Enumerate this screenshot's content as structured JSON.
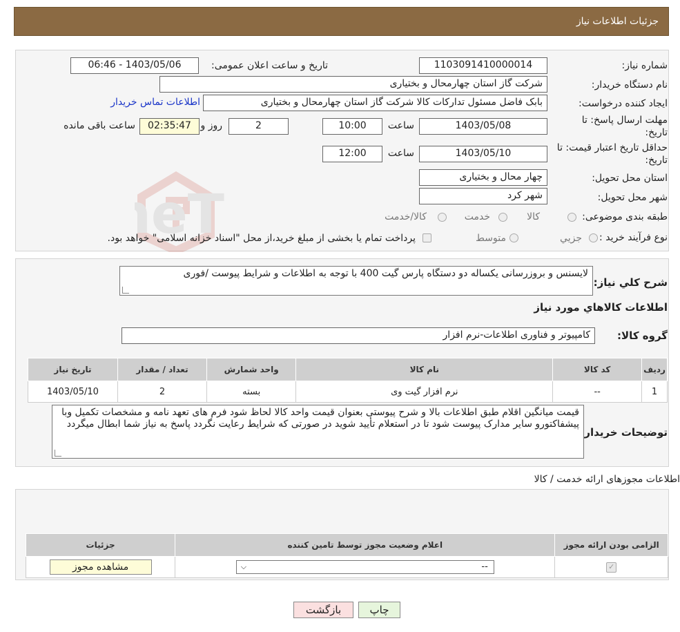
{
  "header": {
    "title": "جزئیات اطلاعات نیاز"
  },
  "details": {
    "need_number_label": "شماره نیاز:",
    "need_number": "1103091410000014",
    "announce_label": "تاریخ و ساعت اعلان عمومی:",
    "announce_value": "1403/05/06 - 06:46",
    "buyer_org_label": "نام دستگاه خریدار:",
    "buyer_org": "شرکت گاز استان چهارمحال و بختیاری",
    "creator_label": "ایجاد کننده درخواست:",
    "creator": "بابک فاضل  مسئول تدارکات کالا شرکت گاز استان چهارمحال و بختیاری",
    "contact_link": "اطلاعات تماس خریدار",
    "deadline_label_1": "مهلت ارسال پاسخ: تا",
    "deadline_label_2": "تاریخ:",
    "deadline_date": "1403/05/08",
    "time_label": "ساعت",
    "deadline_time": "10:00",
    "days_value": "2",
    "days_label": "روز و",
    "remaining_time": "02:35:47",
    "remaining_label": "ساعت باقی مانده",
    "validity_label_1": "حداقل تاریخ اعتبار قیمت: تا",
    "validity_label_2": "تاریخ:",
    "validity_date": "1403/05/10",
    "validity_time": "12:00",
    "province_label": "استان محل تحویل:",
    "province": "چهار محال و بختیاری",
    "city_label": "شهر محل تحویل:",
    "city": "شهر کرد",
    "category_label": "طبقه بندی موضوعی:",
    "category_options": [
      "کالا",
      "خدمت",
      "کالا/خدمت"
    ],
    "process_label": "نوع فرآیند خرید :",
    "process_options": [
      "جزیي",
      "متوسط"
    ],
    "payment_note": "پرداخت تمام یا بخشی از مبلغ خرید،از محل \"اسناد خزانه اسلامی\" خواهد بود."
  },
  "need": {
    "summary_label": "شرح كلي نياز:",
    "summary": "لایسنس و بروزرسانی یکساله دو دستگاه پارس گیت 400 با توجه به اطلاعات و شرایط پیوست /فوری",
    "goods_info_title": "اطلاعات كالاهاي مورد نياز",
    "group_label": "گروه کالا:",
    "group_value": "کامپیوتر و فناوری اطلاعات-نرم افزار",
    "table_headers": [
      "رديف",
      "کد کالا",
      "نام کالا",
      "واحد شمارش",
      "تعداد / مقدار",
      "تاریخ نیاز"
    ],
    "table_rows": [
      [
        "1",
        "--",
        "نرم افزار گیت وی",
        "بسته",
        "2",
        "1403/05/10"
      ]
    ],
    "buyer_notes_label": "توضیحات خریدار:",
    "buyer_notes": "قیمت میانگین اقلام طبق اطلاعات بالا و شرح پیوستی بعنوان قیمت واحد  کالا  لحاظ شود فرم های تعهد نامه و مشخصات تکمیل وبا پیشفاکتورو سایر مدارک پیوست شود تا در استعلام تأیید شوید در صورتی که شرایط رعایت نگردد پاسخ به نیاز شما ابطال میگردد"
  },
  "permits": {
    "title": "اطلاعات مجوزهای ارائه خدمت / کالا",
    "headers": [
      "الزامی بودن ارائه مجوز",
      "اعلام وضعیت مجوز توسط تامین کننده",
      "جزئیات"
    ],
    "select_value": "--",
    "view_button": "مشاهده مجوز"
  },
  "buttons": {
    "print": "چاپ",
    "back": "بازگشت"
  },
  "colors": {
    "header_bg": "#8b6a43",
    "link": "#1a35c8",
    "back_bg": "#fbe0e0",
    "print_bg": "#e6f5dc"
  }
}
